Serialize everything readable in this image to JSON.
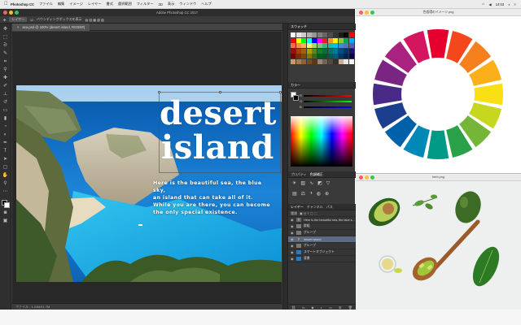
{
  "menubar": {
    "app": "Photoshop CC",
    "items": [
      "ファイル",
      "編集",
      "イメージ",
      "レイヤー",
      "書式",
      "選択範囲",
      "フィルター",
      "3D",
      "表示",
      "ウィンドウ",
      "ヘルプ"
    ],
    "clock": "14:03"
  },
  "ps_window": {
    "title": "Adobe Photoshop CC 2017",
    "options_bar": {
      "layer_select": "レイヤー",
      "transform_check": "バウンディングボックスを表示"
    },
    "document_tab": {
      "label": "sea.psd @ 100% (desert island, RGB/8#)",
      "close": "×"
    },
    "status_bar": "ファイル : 1.24M/11.7M"
  },
  "artwork": {
    "headline_line1": "desert",
    "headline_line2": "island",
    "body_lines": [
      "Here is the beautiful sea, the blue sky,",
      "an island that can take all of it.",
      "While you are there, you can become",
      "the only special existence."
    ]
  },
  "panels": {
    "swatches_tab": "スウォッチ",
    "color_tab": "カラー",
    "properties_tab": "プロパティ",
    "adjust_tab": "色調補正",
    "layers_tabs": [
      "レイヤー",
      "チャンネル",
      "パス"
    ],
    "layers_filter": "種類",
    "layers": [
      {
        "name": "Here is the beautiful sea, the blue s...",
        "type": "T",
        "selected": false
      },
      {
        "name": "群組",
        "type": "folder",
        "selected": false
      },
      {
        "name": "グループ",
        "type": "folder",
        "selected": false
      },
      {
        "name": "desert island",
        "type": "T",
        "selected": true
      },
      {
        "name": "グループ",
        "type": "folder",
        "selected": false
      },
      {
        "name": "スマートオブジェクト",
        "type": "img",
        "selected": false
      },
      {
        "name": "背景",
        "type": "img",
        "selected": false
      }
    ]
  },
  "windows": {
    "color_wheel_title": "色相環のイメージ.png",
    "food_title": "herb.png"
  },
  "colors": {
    "ps_dark": "#3c3c3c",
    "selection": "#5b6a80",
    "wheel": [
      "#e6002d",
      "#f4471b",
      "#f7801e",
      "#fbb01b",
      "#f9df14",
      "#c7d61e",
      "#75b638",
      "#2aa049",
      "#009a86",
      "#0088b7",
      "#0061a8",
      "#1b3f8e",
      "#4a2a87",
      "#7a2584",
      "#a9227f",
      "#d3165f"
    ],
    "swatches": [
      "#ffffff",
      "#e6e6e6",
      "#cccccc",
      "#b3b3b3",
      "#999999",
      "#808080",
      "#666666",
      "#4d4d4d",
      "#333333",
      "#1a1a1a",
      "#000000",
      "#ff0000",
      "#ff0000",
      "#ffff00",
      "#00ff00",
      "#00ffff",
      "#0000ff",
      "#ff00ff",
      "#ed1c24",
      "#f7941d",
      "#fff200",
      "#8dc63f",
      "#00a651",
      "#00aeef",
      "#f26c4f",
      "#f68e55",
      "#fbaf5c",
      "#fff467",
      "#acd372",
      "#7cc576",
      "#3bb878",
      "#1abbb4",
      "#00bff3",
      "#438ccb",
      "#5574b9",
      "#605ca8",
      "#9e0b0f",
      "#a0410d",
      "#a36209",
      "#aba000",
      "#598527",
      "#1a7b30",
      "#007236",
      "#00746b",
      "#0076a3",
      "#004b80",
      "#003471",
      "#1b1464",
      "#790000",
      "#7b2e00",
      "#7d4900",
      "#827b00",
      "#406618",
      "#005e20",
      "#005826",
      "#005952",
      "#005b7f",
      "#003663",
      "#002157",
      "#0d004c",
      "#c69c6d",
      "#a67c52",
      "#8c6239",
      "#754c24",
      "#603813",
      "#998675",
      "#736357",
      "#534741",
      "#362f2d",
      "#c7b299",
      "#e6e6e6",
      "#f5f5f5"
    ]
  }
}
